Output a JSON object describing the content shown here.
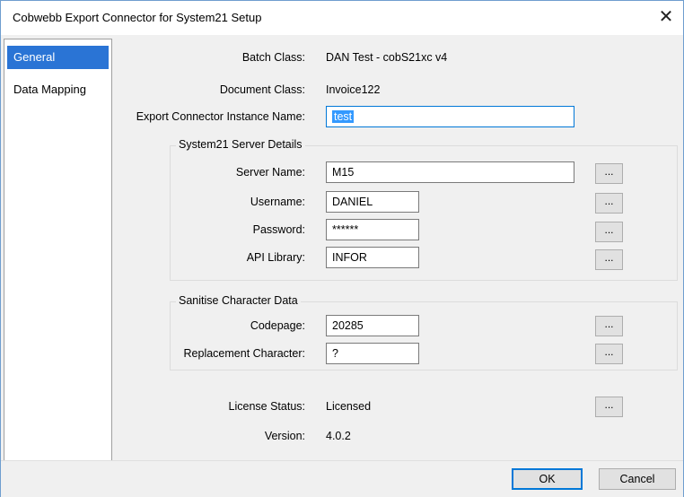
{
  "window": {
    "title": "Cobwebb Export Connector for System21 Setup",
    "close_glyph": "✕"
  },
  "sidebar": {
    "items": [
      {
        "label": "General",
        "selected": true
      },
      {
        "label": "Data Mapping",
        "selected": false
      }
    ]
  },
  "general": {
    "batch_class_label": "Batch Class:",
    "batch_class_value": "DAN Test - cobS21xc v4",
    "document_class_label": "Document Class:",
    "document_class_value": "Invoice122",
    "instance_name_label": "Export Connector Instance Name:",
    "instance_name_value": "test"
  },
  "server_details": {
    "title": "System21 Server Details",
    "server_name_label": "Server Name:",
    "server_name_value": "M15",
    "username_label": "Username:",
    "username_value": "DANIEL",
    "password_label": "Password:",
    "password_value": "******",
    "api_library_label": "API Library:",
    "api_library_value": "INFOR"
  },
  "sanitise": {
    "title": "Sanitise Character Data",
    "codepage_label": "Codepage:",
    "codepage_value": "20285",
    "replacement_label": "Replacement Character:",
    "replacement_value": "?"
  },
  "license": {
    "status_label": "License Status:",
    "status_value": "Licensed",
    "version_label": "Version:",
    "version_value": "4.0.2"
  },
  "browse_glyph": "...",
  "footer": {
    "ok_label": "OK",
    "cancel_label": "Cancel"
  },
  "colors": {
    "selection": "#2a74d5",
    "focus_border": "#0078d7",
    "text_selection": "#3399ff"
  }
}
